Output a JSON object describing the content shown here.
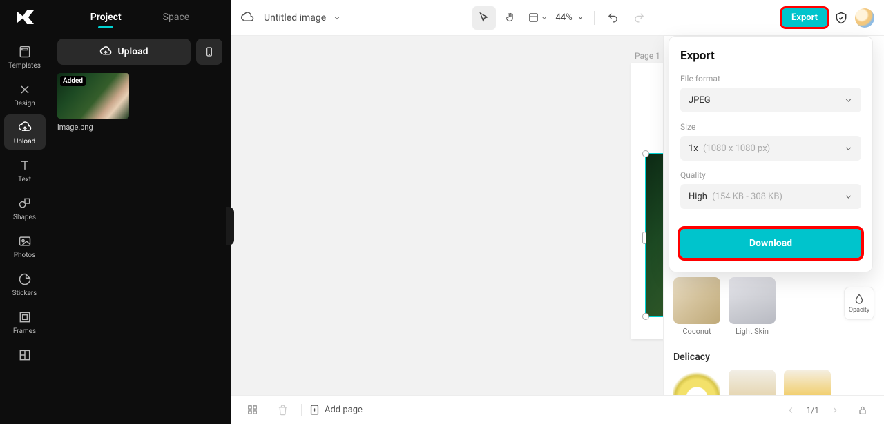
{
  "rail": {
    "items": [
      {
        "label": "Templates"
      },
      {
        "label": "Design"
      },
      {
        "label": "Upload"
      },
      {
        "label": "Text"
      },
      {
        "label": "Shapes"
      },
      {
        "label": "Photos"
      },
      {
        "label": "Stickers"
      },
      {
        "label": "Frames"
      }
    ]
  },
  "project_panel": {
    "tabs": {
      "project": "Project",
      "space": "Space"
    },
    "upload_label": "Upload",
    "thumb_badge": "Added",
    "thumb_name": "image.png"
  },
  "topbar": {
    "title": "Untitled image",
    "zoom": "44%",
    "export_label": "Export"
  },
  "canvas": {
    "page_label": "Page 1"
  },
  "export_panel": {
    "heading": "Export",
    "file_format_label": "File format",
    "file_format_value": "JPEG",
    "size_label": "Size",
    "size_value": "1x",
    "size_dim": "(1080 x 1080 px)",
    "quality_label": "Quality",
    "quality_value": "High",
    "quality_dim": "(154 KB - 308 KB)",
    "download_label": "Download"
  },
  "right_panel": {
    "thumbs": [
      {
        "label": "Coconut"
      },
      {
        "label": "Light Skin"
      }
    ],
    "section": "Delicacy",
    "opacity_label": "Opacity"
  },
  "bottombar": {
    "add_page": "Add page",
    "page_count": "1/1"
  }
}
